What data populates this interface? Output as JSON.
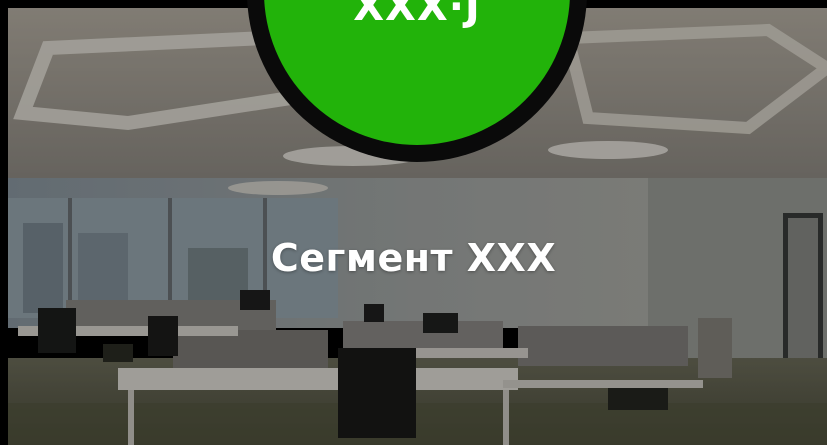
{
  "badge": {
    "text": "XXX·J",
    "fill_color": "#22b30a",
    "ring_color": "#0a0a0a"
  },
  "main": {
    "title": "Сегмент XXX"
  },
  "colors": {
    "frame": "#000000",
    "text": "#ffffff"
  }
}
